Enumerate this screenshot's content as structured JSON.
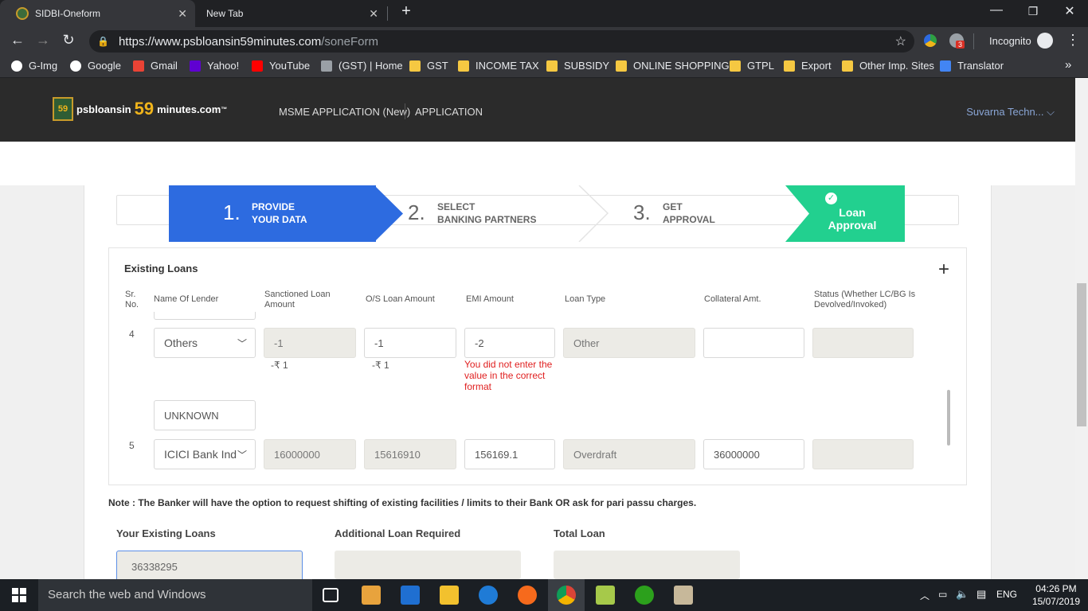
{
  "browser": {
    "tabs": [
      {
        "title": "SIDBI-Oneform",
        "active": true
      },
      {
        "title": "New Tab",
        "active": false
      }
    ],
    "url_host": "https://www.psbloansin59minutes.com",
    "url_path": "/soneForm",
    "incognito_label": "Incognito",
    "extension_badge": "3",
    "bookmarks": [
      "G-Img",
      "Google",
      "Gmail",
      "Yahoo!",
      "YouTube",
      "(GST) | Home",
      "GST",
      "INCOME TAX",
      "SUBSIDY",
      "ONLINE SHOPPING",
      "GTPL",
      "Export",
      "Other Imp. Sites",
      "Translator"
    ],
    "more": "»"
  },
  "site": {
    "logo_text_pre": "psbloansin",
    "logo_59": "59",
    "logo_text_post": "minutes.com",
    "logo_tm": "™",
    "logo_badge": "59",
    "nav": [
      "MSME APPLICATION (New)",
      "APPLICATION"
    ],
    "user": "Suvarna Techn..."
  },
  "steps": [
    {
      "num": "1.",
      "line1": "PROVIDE",
      "line2": "YOUR DATA"
    },
    {
      "num": "2.",
      "line1": "SELECT",
      "line2": "BANKING PARTNERS"
    },
    {
      "num": "3.",
      "line1": "GET",
      "line2": "APPROVAL"
    },
    {
      "line1": "Loan",
      "line2": "Approval"
    }
  ],
  "existing_loans": {
    "title": "Existing Loans",
    "columns": {
      "srno": "Sr. No.",
      "lender": "Name Of Lender",
      "sanctioned": "Sanctioned Loan Amount",
      "os": "O/S Loan Amount",
      "emi": "EMI Amount",
      "type": "Loan Type",
      "collateral": "Collateral Amt.",
      "status": "Status (Whether LC/BG Is Devolved/Invoked)"
    },
    "rows": [
      {
        "sr": "4",
        "lender": "Others",
        "sanctioned": "-1",
        "sanctioned_sub": "-₹ 1",
        "os": "-1",
        "os_sub": "-₹ 1",
        "emi": "-2",
        "emi_error": "You did not enter the value in the correct format",
        "type": "Other",
        "collateral": "",
        "status": "",
        "lender_other": "UNKNOWN"
      },
      {
        "sr": "5",
        "lender": "ICICI Bank Ind",
        "sanctioned": "16000000",
        "os": "15616910",
        "emi": "156169.1",
        "type": "Overdraft",
        "collateral": "36000000",
        "status": ""
      }
    ]
  },
  "note": "Note : The Banker will have the option to request shifting of existing facilities / limits to their Bank OR ask for pari passu charges.",
  "totals": {
    "existing_label": "Your Existing Loans",
    "existing_value": "36338295",
    "additional_label": "Additional Loan Required",
    "total_label": "Total Loan"
  },
  "taskbar": {
    "search_placeholder": "Search the web and Windows",
    "lang": "ENG",
    "time": "04:26 PM",
    "date": "15/07/2019"
  }
}
